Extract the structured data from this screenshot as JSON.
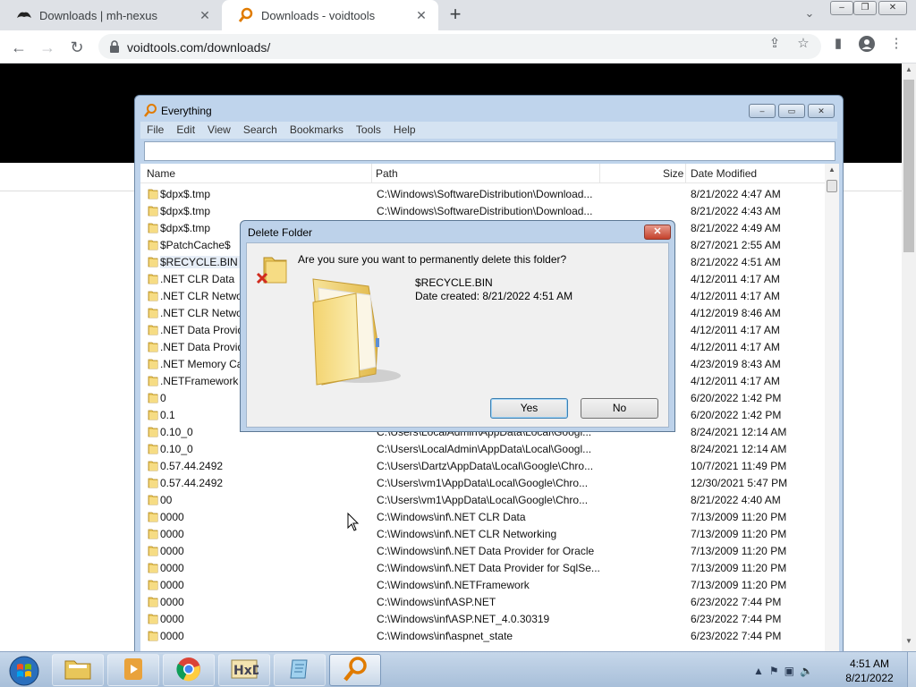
{
  "browser": {
    "tabs": [
      {
        "title": "Downloads | mh-nexus",
        "active": false,
        "icon": "mh-nexus-favicon"
      },
      {
        "title": "Downloads - voidtools",
        "active": true,
        "icon": "voidtools-favicon"
      }
    ],
    "new_tab_symbol": "+",
    "url": "voidtools.com/downloads/"
  },
  "everything": {
    "title": "Everything",
    "menu": [
      "File",
      "Edit",
      "View",
      "Search",
      "Bookmarks",
      "Tools",
      "Help"
    ],
    "search_value": "",
    "columns": {
      "name": "Name",
      "path": "Path",
      "size": "Size",
      "date": "Date Modified"
    },
    "rows": [
      {
        "name": "$dpx$.tmp",
        "path": "C:\\Windows\\SoftwareDistribution\\Download...",
        "date": "8/21/2022 4:47 AM"
      },
      {
        "name": "$dpx$.tmp",
        "path": "C:\\Windows\\SoftwareDistribution\\Download...",
        "date": "8/21/2022 4:43 AM"
      },
      {
        "name": "$dpx$.tmp",
        "path": "",
        "date": "8/21/2022 4:49 AM"
      },
      {
        "name": "$PatchCache$",
        "path": "",
        "date": "8/27/2021 2:55 AM"
      },
      {
        "name": "$RECYCLE.BIN",
        "path": "",
        "date": "8/21/2022 4:51 AM",
        "selected": true
      },
      {
        "name": ".NET CLR Data",
        "path": "",
        "date": "4/12/2011 4:17 AM"
      },
      {
        "name": ".NET CLR Networ",
        "path": "",
        "date": "4/12/2011 4:17 AM"
      },
      {
        "name": ".NET CLR Networ",
        "path": "",
        "date": "4/12/2019 8:46 AM"
      },
      {
        "name": ".NET Data Provid",
        "path": "",
        "date": "4/12/2011 4:17 AM"
      },
      {
        "name": ".NET Data Provid",
        "path": "",
        "date": "4/12/2011 4:17 AM"
      },
      {
        "name": ".NET Memory Ca",
        "path": "",
        "date": "4/23/2019 8:43 AM"
      },
      {
        "name": ".NETFramework",
        "path": "",
        "date": "4/12/2011 4:17 AM"
      },
      {
        "name": "0",
        "path": "",
        "date": "6/20/2022 1:42 PM"
      },
      {
        "name": "0.1",
        "path": "",
        "date": "6/20/2022 1:42 PM"
      },
      {
        "name": "0.10_0",
        "path": "C:\\Users\\LocalAdmin\\AppData\\Local\\Googl...",
        "date": "8/24/2021 12:14 AM"
      },
      {
        "name": "0.10_0",
        "path": "C:\\Users\\LocalAdmin\\AppData\\Local\\Googl...",
        "date": "8/24/2021 12:14 AM"
      },
      {
        "name": "0.57.44.2492",
        "path": "C:\\Users\\Dartz\\AppData\\Local\\Google\\Chro...",
        "date": "10/7/2021 11:49 PM"
      },
      {
        "name": "0.57.44.2492",
        "path": "C:\\Users\\vm1\\AppData\\Local\\Google\\Chro...",
        "date": "12/30/2021 5:47 PM"
      },
      {
        "name": "00",
        "path": "C:\\Users\\vm1\\AppData\\Local\\Google\\Chro...",
        "date": "8/21/2022 4:40 AM"
      },
      {
        "name": "0000",
        "path": "C:\\Windows\\inf\\.NET CLR Data",
        "date": "7/13/2009 11:20 PM"
      },
      {
        "name": "0000",
        "path": "C:\\Windows\\inf\\.NET CLR Networking",
        "date": "7/13/2009 11:20 PM"
      },
      {
        "name": "0000",
        "path": "C:\\Windows\\inf\\.NET Data Provider for Oracle",
        "date": "7/13/2009 11:20 PM"
      },
      {
        "name": "0000",
        "path": "C:\\Windows\\inf\\.NET Data Provider for SqlSe...",
        "date": "7/13/2009 11:20 PM"
      },
      {
        "name": "0000",
        "path": "C:\\Windows\\inf\\.NETFramework",
        "date": "7/13/2009 11:20 PM"
      },
      {
        "name": "0000",
        "path": "C:\\Windows\\inf\\ASP.NET",
        "date": "6/23/2022 7:44 PM"
      },
      {
        "name": "0000",
        "path": "C:\\Windows\\inf\\ASP.NET_4.0.30319",
        "date": "6/23/2022 7:44 PM"
      },
      {
        "name": "0000",
        "path": "C:\\Windows\\inf\\aspnet_state",
        "date": "6/23/2022 7:44 PM"
      }
    ]
  },
  "dialog": {
    "title": "Delete Folder",
    "question": "Are you sure you want to permanently delete this folder?",
    "item_name": "$RECYCLE.BIN",
    "item_date": "Date created: 8/21/2022 4:51 AM",
    "yes_label": "Yes",
    "no_label": "No"
  },
  "taskbar": {
    "apps": [
      "explorer",
      "media-player",
      "chrome",
      "hxd",
      "notepad",
      "everything"
    ],
    "time": "4:51 AM",
    "date": "8/21/2022"
  }
}
